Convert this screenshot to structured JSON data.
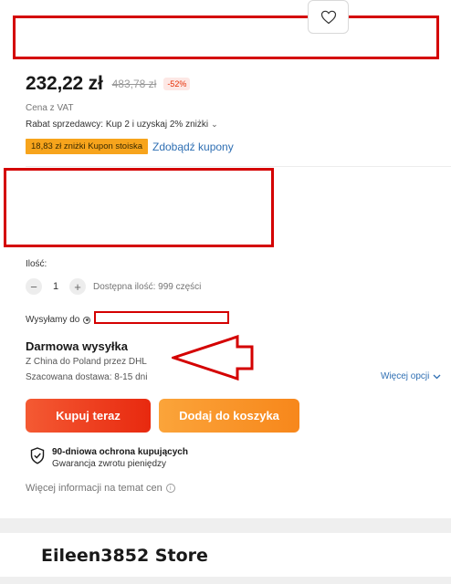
{
  "price": {
    "current": "232,22 zł",
    "original": "483,78 zł",
    "discount": "-52%",
    "vat_note": "Cena z VAT"
  },
  "seller_discount": {
    "text": "Rabat sprzedawcy: Kup 2 i uzyskaj 2% zniżki",
    "chevron": "⌄"
  },
  "coupon": {
    "tag": "18,83 zł zniżki Kupon stoiska",
    "link": "Zdobądź kupony"
  },
  "quantity": {
    "label": "Ilość:",
    "minus": "−",
    "value": "1",
    "plus": "+",
    "stock": "Dostępna ilość: 999 części"
  },
  "shipping": {
    "ship_to_label": "Wysyłamy do",
    "free_title": "Darmowa wysyłka",
    "route": "Z China do Poland przez DHL",
    "eta": "Szacowana dostawa: 8-15 dni",
    "more_options": "Więcej opcji"
  },
  "actions": {
    "buy_now": "Kupuj teraz",
    "add_to_cart": "Dodaj do koszyka"
  },
  "protection": {
    "title": "90-dniowa ochrona kupujących",
    "subtitle": "Gwarancja zwrotu pieniędzy"
  },
  "price_info": {
    "text": "Więcej informacji na temat cen",
    "icon_glyph": "i"
  },
  "store": {
    "name": "Eileen3852 Store"
  },
  "colors": {
    "annotation_red": "#d40000",
    "buy_now": "#e8290f",
    "add_to_cart": "#f7871b",
    "link_blue": "#2f6fb3",
    "coupon_orange": "#f7a41c"
  }
}
